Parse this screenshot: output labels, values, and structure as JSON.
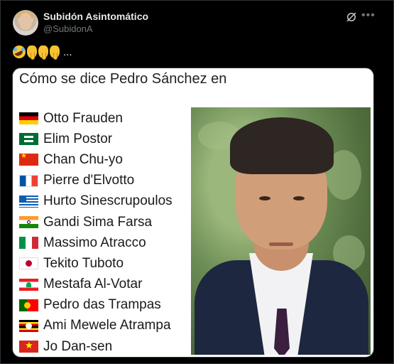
{
  "author": {
    "display_name": "Subidón Asintomático",
    "handle": "@SubidonA"
  },
  "header_icons": [
    "grok-icon",
    "more-icon"
  ],
  "tweet": {
    "emojis": [
      "rolling-on-floor-laughing",
      "backhand-index-pointing-down",
      "backhand-index-pointing-down",
      "backhand-index-pointing-down"
    ],
    "trailing_text": "..."
  },
  "card": {
    "title": "Cómo se dice Pedro Sánchez en",
    "items": [
      {
        "flag": "de",
        "text": "Otto Frauden"
      },
      {
        "flag": "sa",
        "text": "Elim Postor"
      },
      {
        "flag": "cn",
        "text": "Chan Chu-yo"
      },
      {
        "flag": "fr",
        "text": "Pierre d'Elvotto"
      },
      {
        "flag": "gr",
        "text": "Hurto Sinescrupoulos"
      },
      {
        "flag": "in",
        "text": "Gandi Sima Farsa"
      },
      {
        "flag": "it",
        "text": "Massimo Atracco"
      },
      {
        "flag": "jp",
        "text": "Tekito Tuboto"
      },
      {
        "flag": "lb",
        "text": "Mestafa Al-Votar"
      },
      {
        "flag": "pt",
        "text": "Pedro das Trampas"
      },
      {
        "flag": "ug",
        "text": "Ami Mewele Atrampa"
      },
      {
        "flag": "vn",
        "text": "Jo Dan-sen"
      }
    ]
  },
  "colors": {
    "background": "#000000",
    "text_primary": "#e7e9ea",
    "text_secondary": "#71767b",
    "card_bg": "#ffffff"
  }
}
